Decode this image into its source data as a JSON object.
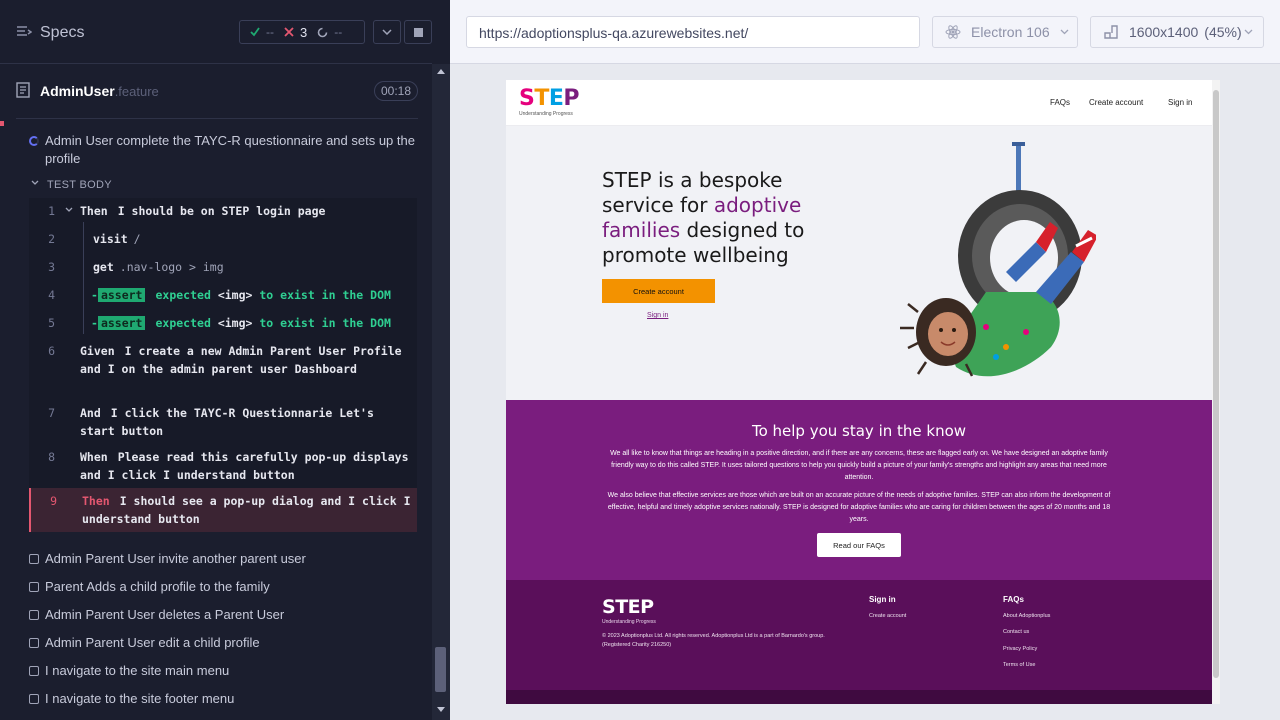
{
  "runner": {
    "header": {
      "title": "Specs",
      "passed": "--",
      "failed": "3",
      "pending": "--"
    },
    "spec": {
      "name": "AdminUser",
      "ext": ".feature",
      "duration": "00:18"
    },
    "current_test": "Admin User complete the TAYC-R questionnaire and sets up the profile",
    "test_body_label": "TEST BODY",
    "commands": [
      {
        "num": "1",
        "kw": "Then",
        "text": "I should be on STEP login page"
      },
      {
        "num": "2",
        "kw": "visit",
        "arg": "/"
      },
      {
        "num": "3",
        "kw": "get",
        "arg": ".nav-logo > img"
      },
      {
        "num": "4",
        "tag": "assert",
        "text_a": "expected",
        "elem": "<img>",
        "text_b": "to exist in the DOM"
      },
      {
        "num": "5",
        "tag": "assert",
        "text_a": "expected",
        "elem": "<img>",
        "text_b": "to exist in the DOM"
      },
      {
        "num": "6",
        "kw": "Given",
        "text": "I create a new Admin Parent User Profile and I on the admin parent user Dashboard"
      },
      {
        "num": "7",
        "kw": "And",
        "text": "I click the TAYC-R Questionnarie Let's start button"
      },
      {
        "num": "8",
        "kw": "When",
        "text": "Please read this carefully pop-up displays and I click I understand button"
      },
      {
        "num": "9",
        "kw": "Then",
        "text": "I should see a pop-up dialog and I click I understand button"
      }
    ],
    "pending_tests": [
      "Admin Parent User invite another parent user",
      "Parent Adds a child profile to the family",
      "Admin Parent User deletes a Parent User",
      "Admin Parent User edit a child profile",
      "I navigate to the site main menu",
      "I navigate to the site footer menu"
    ]
  },
  "browser": {
    "url": "https://adoptionsplus-qa.azurewebsites.net/",
    "browser_name": "Electron 106",
    "viewport": "1600x1400",
    "zoom": "(45%)"
  },
  "site": {
    "logo_letters": [
      "S",
      "T",
      "E",
      "P"
    ],
    "logo_tagline": "Understanding Progress",
    "nav": [
      "FAQs",
      "Create account",
      "Sign in"
    ],
    "hero_line1": "STEP is a bespoke service for ",
    "hero_highlight": "adoptive families",
    "hero_line2": " designed to promote wellbeing",
    "cta_create": "Create account",
    "cta_signin": "Sign in",
    "section_title": "To help you stay in the know",
    "para1": "We all like to know that things are heading in a positive direction, and if there are any concerns, these are flagged early on. We have designed an adoptive family friendly way to do this called STEP. It uses tailored questions to help you quickly build a picture of your family's strengths and highlight any areas that need more attention.",
    "para2": "We also believe that effective services are those which are built on an accurate picture of the needs of adoptive families. STEP can also inform the development of effective, helpful and timely adoptive services nationally. STEP is designed for adoptive families who are caring for children between the ages of 20 months and 18 years.",
    "faq_button": "Read our FAQs",
    "footer": {
      "copyright": "© 2023 Adoptionplus Ltd. All rights reserved. Adoptionplus Ltd is a part of Barnardo's group. (Registered Charity 216250)",
      "col1_title": "Sign in",
      "col1_links": [
        "Create account"
      ],
      "col2_title": "FAQs",
      "col2_links": [
        "About Adoptionplus",
        "Contact us",
        "Privacy Policy",
        "Terms of Use"
      ]
    }
  },
  "colors": {
    "runner_bg": "#1b1e2e",
    "fail_red": "#e45770",
    "pass_green": "#1fa971",
    "step_purple": "#7a1d7e",
    "step_orange": "#f39200",
    "footer_purple": "#5a0f5a"
  },
  "icons": [
    "specs-icon",
    "check-icon",
    "x-icon",
    "spinner-icon",
    "chevron-down-icon",
    "stop-icon",
    "document-icon",
    "electron-icon",
    "viewport-icon"
  ]
}
